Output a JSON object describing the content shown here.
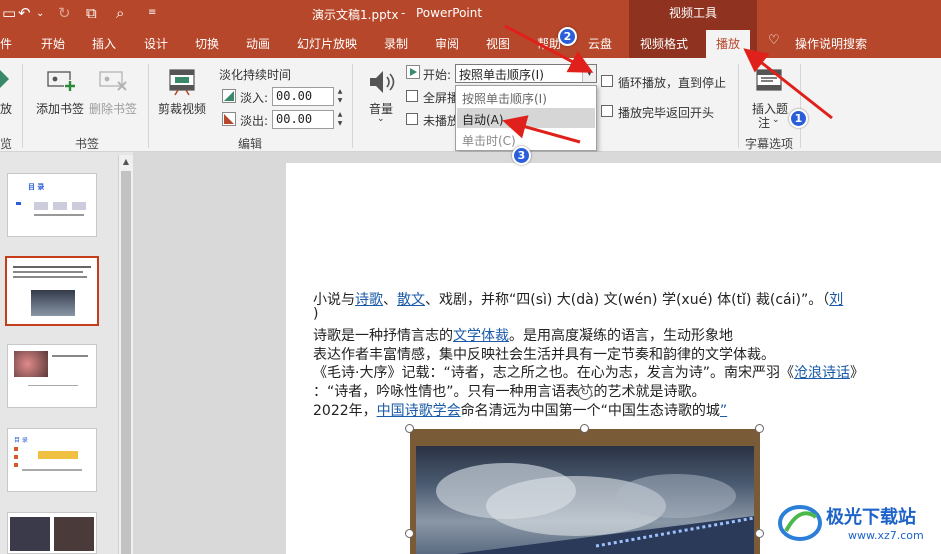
{
  "titlebar": {
    "doc_title": "演示文稿1.pptx",
    "separator": "-",
    "app_name": "PowerPoint",
    "context_group": "视频工具"
  },
  "tabs": [
    {
      "label": "件"
    },
    {
      "label": "开始"
    },
    {
      "label": "插入"
    },
    {
      "label": "设计"
    },
    {
      "label": "切换"
    },
    {
      "label": "动画"
    },
    {
      "label": "幻灯片放映"
    },
    {
      "label": "录制"
    },
    {
      "label": "审阅"
    },
    {
      "label": "视图"
    },
    {
      "label": "帮助"
    },
    {
      "label": "云盘"
    },
    {
      "label": "视频格式"
    },
    {
      "label": "播放"
    },
    {
      "label": "操作说明搜索"
    }
  ],
  "ribbon": {
    "preview": {
      "label": "放",
      "group": "览"
    },
    "bookmarks": {
      "add": "添加书签",
      "remove": "删除书签",
      "group": "书签"
    },
    "editing": {
      "trim": "剪裁视频",
      "fade_title": "淡化持续时间",
      "fade_in_label": "淡入:",
      "fade_in_value": "00.00",
      "fade_out_label": "淡出:",
      "fade_out_value": "00.00",
      "group": "编辑"
    },
    "video_options": {
      "volume": "音量",
      "start_label": "开始:",
      "start_value": "按照单击顺序(I)",
      "fullscreen": "全屏播",
      "hide": "未播放",
      "loop": "循环播放，直到停止",
      "rewind": "播放完毕返回开头"
    },
    "captions": {
      "insert": "插入题",
      "insert2": "注",
      "group": "字幕选项"
    }
  },
  "dropdown": {
    "items": [
      {
        "label": "按照单击顺序(I)",
        "highlighted": false
      },
      {
        "label": "自动(A)",
        "highlighted": true
      },
      {
        "label": "单击时(C)",
        "highlighted": false
      }
    ]
  },
  "slide_text": {
    "line1_a": "小说与",
    "line1_link1": "诗歌",
    "line1_b": "、",
    "line1_link2": "散文",
    "line1_c": "、戏剧，并称“四(sì) 大(dà) 文(wén) 学(xué) 体(tǐ) 裁(cái)”。（",
    "line1_link3": "刘",
    "line1b": ")",
    "line2_a": "诗歌是一种抒情言志的",
    "line2_link": "文学体裁",
    "line2_b": "。是用高度凝练的语言，生动形象地",
    "line3": "表达作者丰富情感，集中反映社会生活并具有一定节奏和韵律的文学体裁。",
    "line4_a": "《毛诗·大序》记载：“诗者，志之所之也。在心为志，发言为诗”。南宋严羽《",
    "line4_link": "沧浪诗话",
    "line4_b": "》",
    "line5": "：“诗者，吟咏性情也”。只有一种用言语表达的艺术就是诗歌。",
    "line6_a": "2022年，",
    "line6_link1": "中国诗歌学会",
    "line6_b": "命名清远为中国第一个“中国生态诗歌的城",
    "line6_link2": "”"
  },
  "thumb1": {
    "title": "目  录"
  },
  "annotations": {
    "b1": "1",
    "b2": "2",
    "b3": "3"
  },
  "watermark": {
    "name": "极光下载站",
    "url": "www.xz7.com"
  },
  "colors": {
    "accent": "#b7472a",
    "context": "#8f3320",
    "arrow": "#e0201a",
    "badge": "#2b5fd9",
    "link": "#1a5aa8"
  }
}
